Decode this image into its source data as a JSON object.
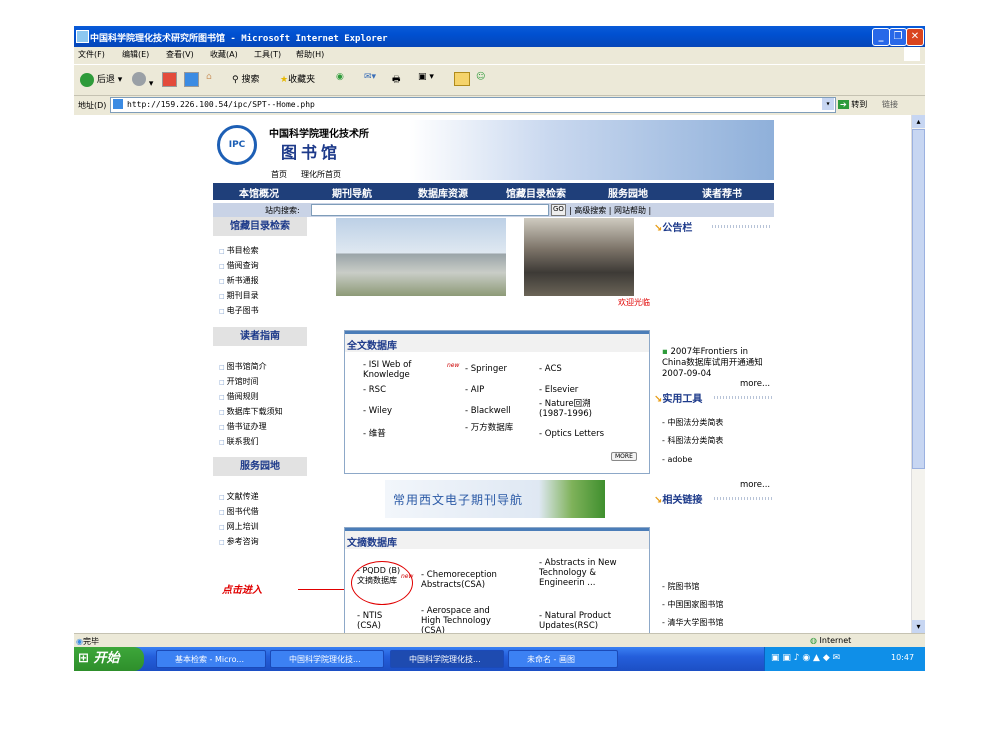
{
  "window": {
    "title": "中国科学院理化技术研究所图书馆 - Microsoft Internet Explorer"
  },
  "menu": [
    "文件(F)",
    "编辑(E)",
    "查看(V)",
    "收藏(A)",
    "工具(T)",
    "帮助(H)"
  ],
  "toolbar": {
    "back": "后退",
    "search": "搜索",
    "favorites": "收藏夹"
  },
  "address": {
    "label": "地址(D)",
    "url": "http://159.226.100.54/ipc/SPT--Home.php",
    "go": "转到",
    "links": "链接"
  },
  "page": {
    "logo": {
      "line1": "中国科学院理化技术所",
      "line2": "图书馆",
      "seal": "IPC"
    },
    "toplinks": [
      "首页",
      "理化所首页"
    ],
    "nav": [
      "本馆概况",
      "期刊导航",
      "数据库资源",
      "馆藏目录检索",
      "服务园地",
      "读者荐书"
    ],
    "search": {
      "label": "站内搜索:",
      "go": "GO",
      "advanced": "| 高级搜索 | 网站帮助 |"
    },
    "sidebar": [
      {
        "title": "馆藏目录检索",
        "items": [
          "书目检索",
          "借阅查询",
          "新书通报",
          "期刊目录",
          "电子图书"
        ]
      },
      {
        "title": "读者指南",
        "items": [
          "图书馆简介",
          "开馆时间",
          "借阅规则",
          "数据库下载须知",
          "借书证办理",
          "联系我们"
        ]
      },
      {
        "title": "服务园地",
        "items": [
          "文献传递",
          "图书代借",
          "网上培训",
          "参考咨询"
        ]
      }
    ],
    "welcome": "欢迎光临",
    "fulltext": {
      "title": "全文数据库",
      "items": [
        "ISI Web of Knowledge",
        "Springer",
        "ACS",
        "RSC",
        "AIP",
        "Elsevier",
        "Wiley",
        "Blackwell",
        "Nature回溯 (1987-1996)",
        "维普",
        "万方数据库",
        "Optics Letters"
      ],
      "new": "new",
      "more": "MORE"
    },
    "banner": "常用西文电子期刊导航",
    "abstract": {
      "title": "文摘数据库",
      "items": [
        "PQDD (B)文摘数据库",
        "Chemoreception Abstracts(CSA)",
        "Abstracts in New Technology & Engineerin ...",
        "NTIS (CSA)",
        "Aerospace and High Technology (CSA)",
        "Natural Product Updates(RSC)"
      ],
      "new": "new"
    },
    "annotation": "点击进入",
    "announce": {
      "title": "公告栏",
      "item": "2007年Frontiers in China数据库试用开通通知 2007-09-04",
      "more": "more..."
    },
    "tools": {
      "title": "实用工具",
      "items": [
        "中图法分类简表",
        "科图法分类简表",
        "adobe"
      ],
      "more": "more..."
    },
    "related": {
      "title": "相关链接",
      "items": [
        "院图书馆",
        "中国国家图书馆",
        "清华大学图书馆"
      ]
    }
  },
  "status": {
    "text": "完毕",
    "zone": "Internet"
  },
  "taskbar": {
    "start": "开始",
    "tasks": [
      "基本检索 - Micro...",
      "中国科学院理化技...",
      "中国科学院理化技...",
      "未命名 - 画图"
    ],
    "time": "10:47"
  }
}
